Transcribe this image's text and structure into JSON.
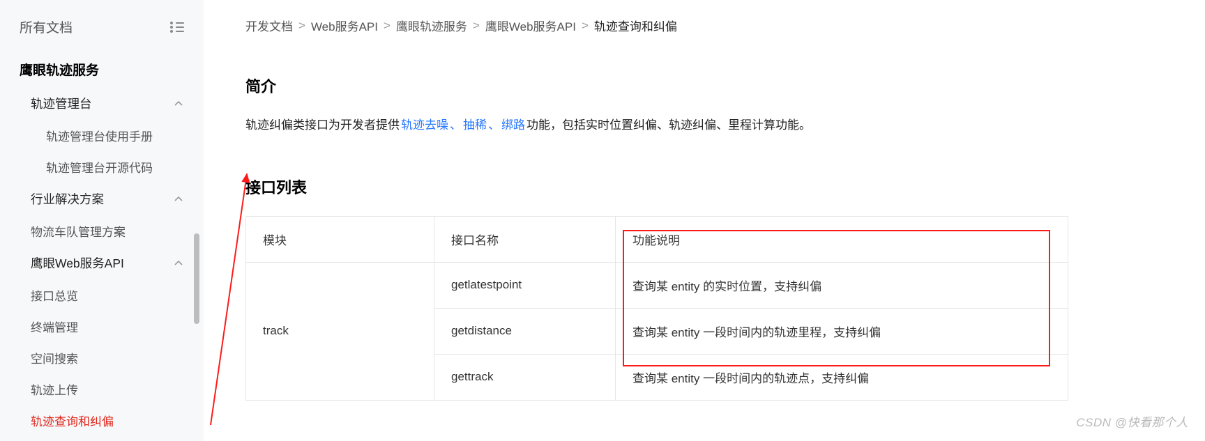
{
  "sidebar": {
    "all_docs": "所有文档",
    "service_title": "鹰眼轨迹服务",
    "track_console": "轨迹管理台",
    "track_console_manual": "轨迹管理台使用手册",
    "track_console_source": "轨迹管理台开源代码",
    "industry_solutions": "行业解决方案",
    "logistics_fleet": "物流车队管理方案",
    "yingyan_web_api": "鹰眼Web服务API",
    "api_overview": "接口总览",
    "terminal_mgmt": "终端管理",
    "spatial_search": "空间搜索",
    "track_upload": "轨迹上传",
    "track_query_correct": "轨迹查询和纠偏"
  },
  "breadcrumb": {
    "b1": "开发文档",
    "b2": "Web服务API",
    "b3": "鹰眼轨迹服务",
    "b4": "鹰眼Web服务API",
    "b5": "轨迹查询和纠偏",
    "sep": ">"
  },
  "intro": {
    "title": "简介",
    "pre": "轨迹纠偏类接口为开发者提供 ",
    "hl1": "轨迹去噪",
    "sep1": "、",
    "hl2": "抽稀",
    "sep2": "、",
    "hl3": "绑路",
    "post": " 功能，包括实时位置纠偏、轨迹纠偏、里程计算功能。"
  },
  "api_list": {
    "title": "接口列表",
    "headers": {
      "module": "模块",
      "ifname": "接口名称",
      "desc": "功能说明"
    },
    "module_name": "track",
    "rows": [
      {
        "name": "getlatestpoint",
        "desc": "查询某 entity 的实时位置，支持纠偏"
      },
      {
        "name": "getdistance",
        "desc": "查询某 entity 一段时间内的轨迹里程，支持纠偏"
      },
      {
        "name": "gettrack",
        "desc": "查询某 entity 一段时间内的轨迹点，支持纠偏"
      }
    ]
  },
  "watermark": "CSDN @快看那个人"
}
